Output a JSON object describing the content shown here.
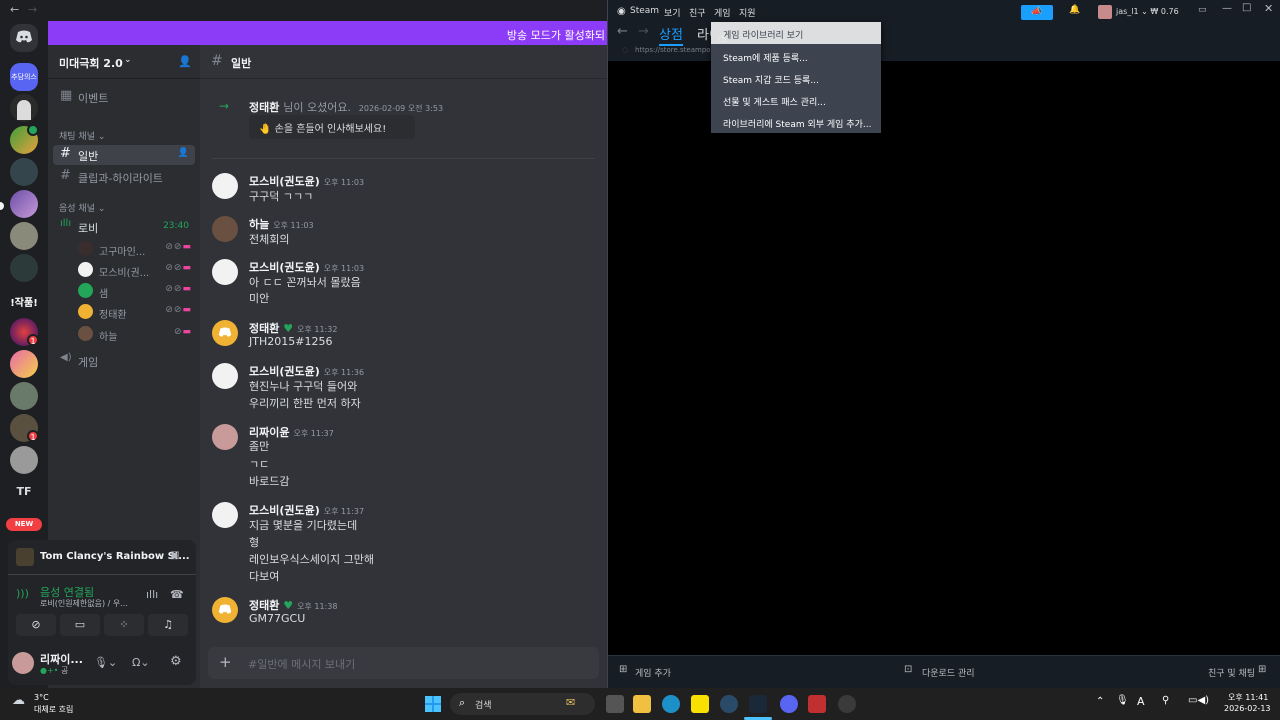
{
  "discord": {
    "banner": "방송 모드가 활성화되",
    "server_name": "미대극회 2.0",
    "server_icons_text": [
      "!작품!",
      "TF"
    ],
    "new_badge": "NEW",
    "badges": [
      "1",
      "1"
    ],
    "channels": {
      "events": "이벤트",
      "text_category": "채팅 채널",
      "text_channels": [
        "일반",
        "클립과-하이라이트"
      ],
      "voice_category": "음성 채널",
      "voice_channel": "로비",
      "voice_time": "23:40",
      "voice_users": [
        "고구마인...",
        "모스비(권...",
        "샘",
        "정태환",
        "하늘"
      ],
      "game_channel": "게임"
    },
    "current_channel": "일반",
    "messages": [
      {
        "author": "정태환",
        "system": "님이 오셨어요.",
        "time": "2026-02-09 오전 3:53",
        "button": "손을 흔들어 인사해보세요!"
      },
      {
        "author": "모스비(권도윤)",
        "time": "오후 11:03",
        "lines": [
          "구구덕 ㄱㄱㄱ"
        ]
      },
      {
        "author": "하늘",
        "time": "오후 11:03",
        "lines": [
          "전체회의"
        ]
      },
      {
        "author": "모스비(권도윤)",
        "time": "오후 11:03",
        "lines": [
          "아 ㄷㄷ 꼰꺼놔서 몰랐음",
          "미안"
        ]
      },
      {
        "author": "정태환",
        "time": "오후 11:32",
        "lines": [
          "JTH2015#1256"
        ]
      },
      {
        "author": "모스비(권도윤)",
        "time": "오후 11:36",
        "lines": [
          "현진누나 구구덕 들어와",
          "우리끼리 한판 먼저 하자"
        ]
      },
      {
        "author": "리짜이윤",
        "time": "오후 11:37",
        "lines": [
          "좀만",
          "ㄱㄷ",
          "바로드감"
        ]
      },
      {
        "author": "모스비(권도윤)",
        "time": "오후 11:37",
        "lines": [
          "지금 몇분을 기다렸는데",
          "형",
          "레인보우식스세이지 그만해",
          "다보여"
        ]
      },
      {
        "author": "정태환",
        "time": "오후 11:38",
        "lines": [
          "GM77GCU"
        ]
      }
    ],
    "input_placeholder": "#일반에 메시지 보내기",
    "activity": "Tom Clancy's Rainbow Si...",
    "voice_status": "음성 연결됨",
    "voice_detail": "로비(인원제한없음) / 우...",
    "username": "리짜이...",
    "user_status": "공"
  },
  "steam": {
    "logo": "Steam",
    "menu": [
      "보기",
      "친구",
      "게임",
      "지원"
    ],
    "user": "jas_l1",
    "balance": "₩ 0.76",
    "tab_store": "상점",
    "tab_library_partial": "라이",
    "url": "https://store.steampow",
    "dropdown": [
      "게임 라이브러리 보기",
      "Steam에 제품 등록...",
      "Steam 지갑 코드 등록...",
      "선물 및 게스트 패스 관리...",
      "라이브러리에 Steam 외부 게임 추가..."
    ],
    "footer_add": "게임 추가",
    "footer_downloads": "다운로드 관리",
    "footer_friends": "친구 및 채팅"
  },
  "taskbar": {
    "temp": "3°C",
    "weather": "대체로 흐림",
    "search": "검색",
    "time": "오후 11:41",
    "date": "2026-02-13",
    "lang": "A"
  }
}
